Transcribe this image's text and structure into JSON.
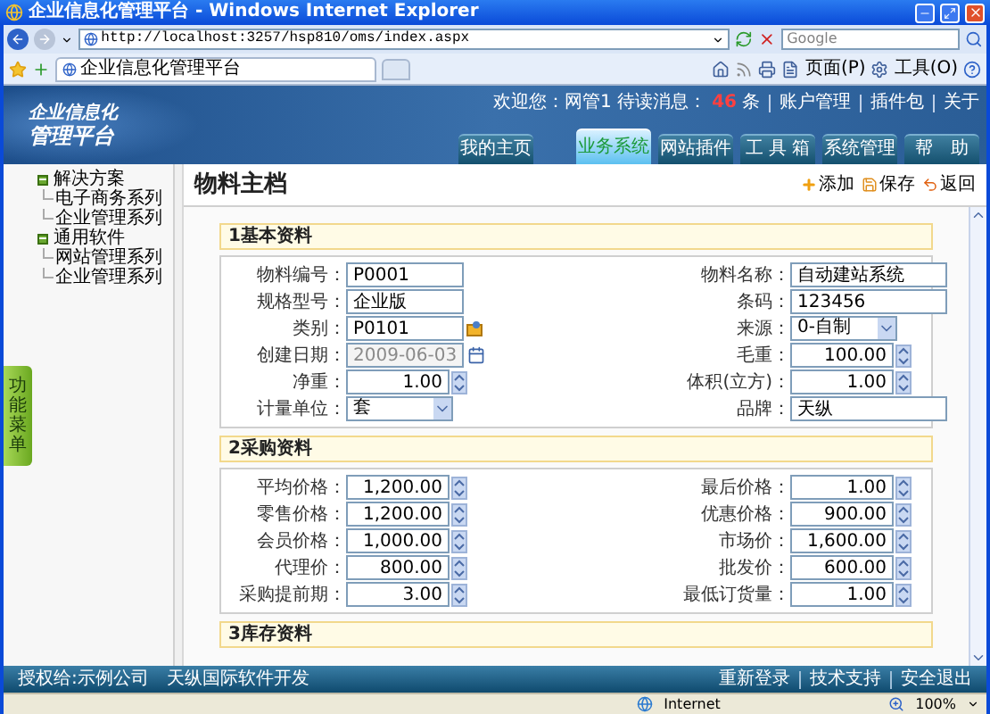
{
  "window": {
    "title": "企业信息化管理平台 - Windows Internet Explorer"
  },
  "browser": {
    "address": "http://localhost:3257/hsp810/oms/index.aspx",
    "search_placeholder": "Google",
    "tab_title": "企业信息化管理平台",
    "toolbar": [
      "页面(P)",
      "工具(O)"
    ]
  },
  "app": {
    "logo": [
      "企业信息化",
      "管理平台"
    ],
    "greeting": "欢迎您：网管1 待读消息：",
    "unread_count": "46",
    "unread_unit": "条",
    "links": [
      "账户管理",
      "插件包",
      "关于"
    ],
    "nav": [
      {
        "label": "我的主页",
        "selected": false
      },
      {
        "label": "业务系统",
        "selected": true
      },
      {
        "label": "网站插件",
        "selected": false
      },
      {
        "label": "工 具 箱",
        "selected": false
      },
      {
        "label": "系统管理",
        "selected": false
      },
      {
        "label": "帮　助",
        "selected": false
      }
    ]
  },
  "sidebar": {
    "tab": "功能菜单",
    "tree": [
      {
        "label": "解决方案",
        "expanded": true,
        "children": [
          {
            "label": "电子商务系列"
          },
          {
            "label": "企业管理系列"
          }
        ]
      },
      {
        "label": "通用软件",
        "expanded": true,
        "children": [
          {
            "label": "网站管理系列"
          },
          {
            "label": "企业管理系列"
          }
        ]
      }
    ]
  },
  "page": {
    "title": "物料主档",
    "actions": [
      "添加",
      "保存",
      "返回"
    ],
    "sections": [
      {
        "title": "1基本资料",
        "left": [
          {
            "label": "物料编号：",
            "kind": "text",
            "value": "P0001",
            "disabled": false
          },
          {
            "label": "规格型号：",
            "kind": "text",
            "value": "企业版",
            "disabled": false
          },
          {
            "label": "类别：",
            "kind": "lookup",
            "value": "P0101",
            "disabled": false
          },
          {
            "label": "创建日期：",
            "kind": "date",
            "value": "2009-06-03",
            "disabled": true
          },
          {
            "label": "净重：",
            "kind": "number",
            "value": "1.00",
            "disabled": false
          },
          {
            "label": "计量单位：",
            "kind": "select",
            "value": "套",
            "disabled": false
          }
        ],
        "right": [
          {
            "label": "物料名称：",
            "kind": "text",
            "value": "自动建站系统",
            "disabled": false
          },
          {
            "label": "条码：",
            "kind": "text",
            "value": "123456",
            "disabled": false
          },
          {
            "label": "来源：",
            "kind": "select",
            "value": "0-自制",
            "disabled": false
          },
          {
            "label": "毛重：",
            "kind": "number",
            "value": "100.00",
            "disabled": false
          },
          {
            "label": "体积(立方)：",
            "kind": "number",
            "value": "1.00",
            "disabled": false
          },
          {
            "label": "品牌：",
            "kind": "text",
            "value": "天纵",
            "disabled": false
          }
        ]
      },
      {
        "title": "2采购资料",
        "left": [
          {
            "label": "平均价格：",
            "kind": "number",
            "value": "1,200.00",
            "disabled": false
          },
          {
            "label": "零售价格：",
            "kind": "number",
            "value": "1,200.00",
            "disabled": false
          },
          {
            "label": "会员价格：",
            "kind": "number",
            "value": "1,000.00",
            "disabled": false
          },
          {
            "label": "代理价：",
            "kind": "number",
            "value": "800.00",
            "disabled": false
          },
          {
            "label": "采购提前期：",
            "kind": "number",
            "value": "3.00",
            "disabled": false
          }
        ],
        "right": [
          {
            "label": "最后价格：",
            "kind": "number",
            "value": "1.00",
            "disabled": false
          },
          {
            "label": "优惠价格：",
            "kind": "number",
            "value": "900.00",
            "disabled": false
          },
          {
            "label": "市场价：",
            "kind": "number",
            "value": "1,600.00",
            "disabled": false
          },
          {
            "label": "批发价：",
            "kind": "number",
            "value": "600.00",
            "disabled": false
          },
          {
            "label": "最低订货量：",
            "kind": "number",
            "value": "1.00",
            "disabled": false
          }
        ]
      },
      {
        "title": "3库存资料"
      }
    ]
  },
  "footer": {
    "text": "授权给:示例公司　天纵国际软件开发",
    "links": [
      "重新登录",
      "技术支持",
      "安全退出"
    ]
  },
  "status_bar": {
    "zone": "Internet",
    "zoom": "100%"
  }
}
